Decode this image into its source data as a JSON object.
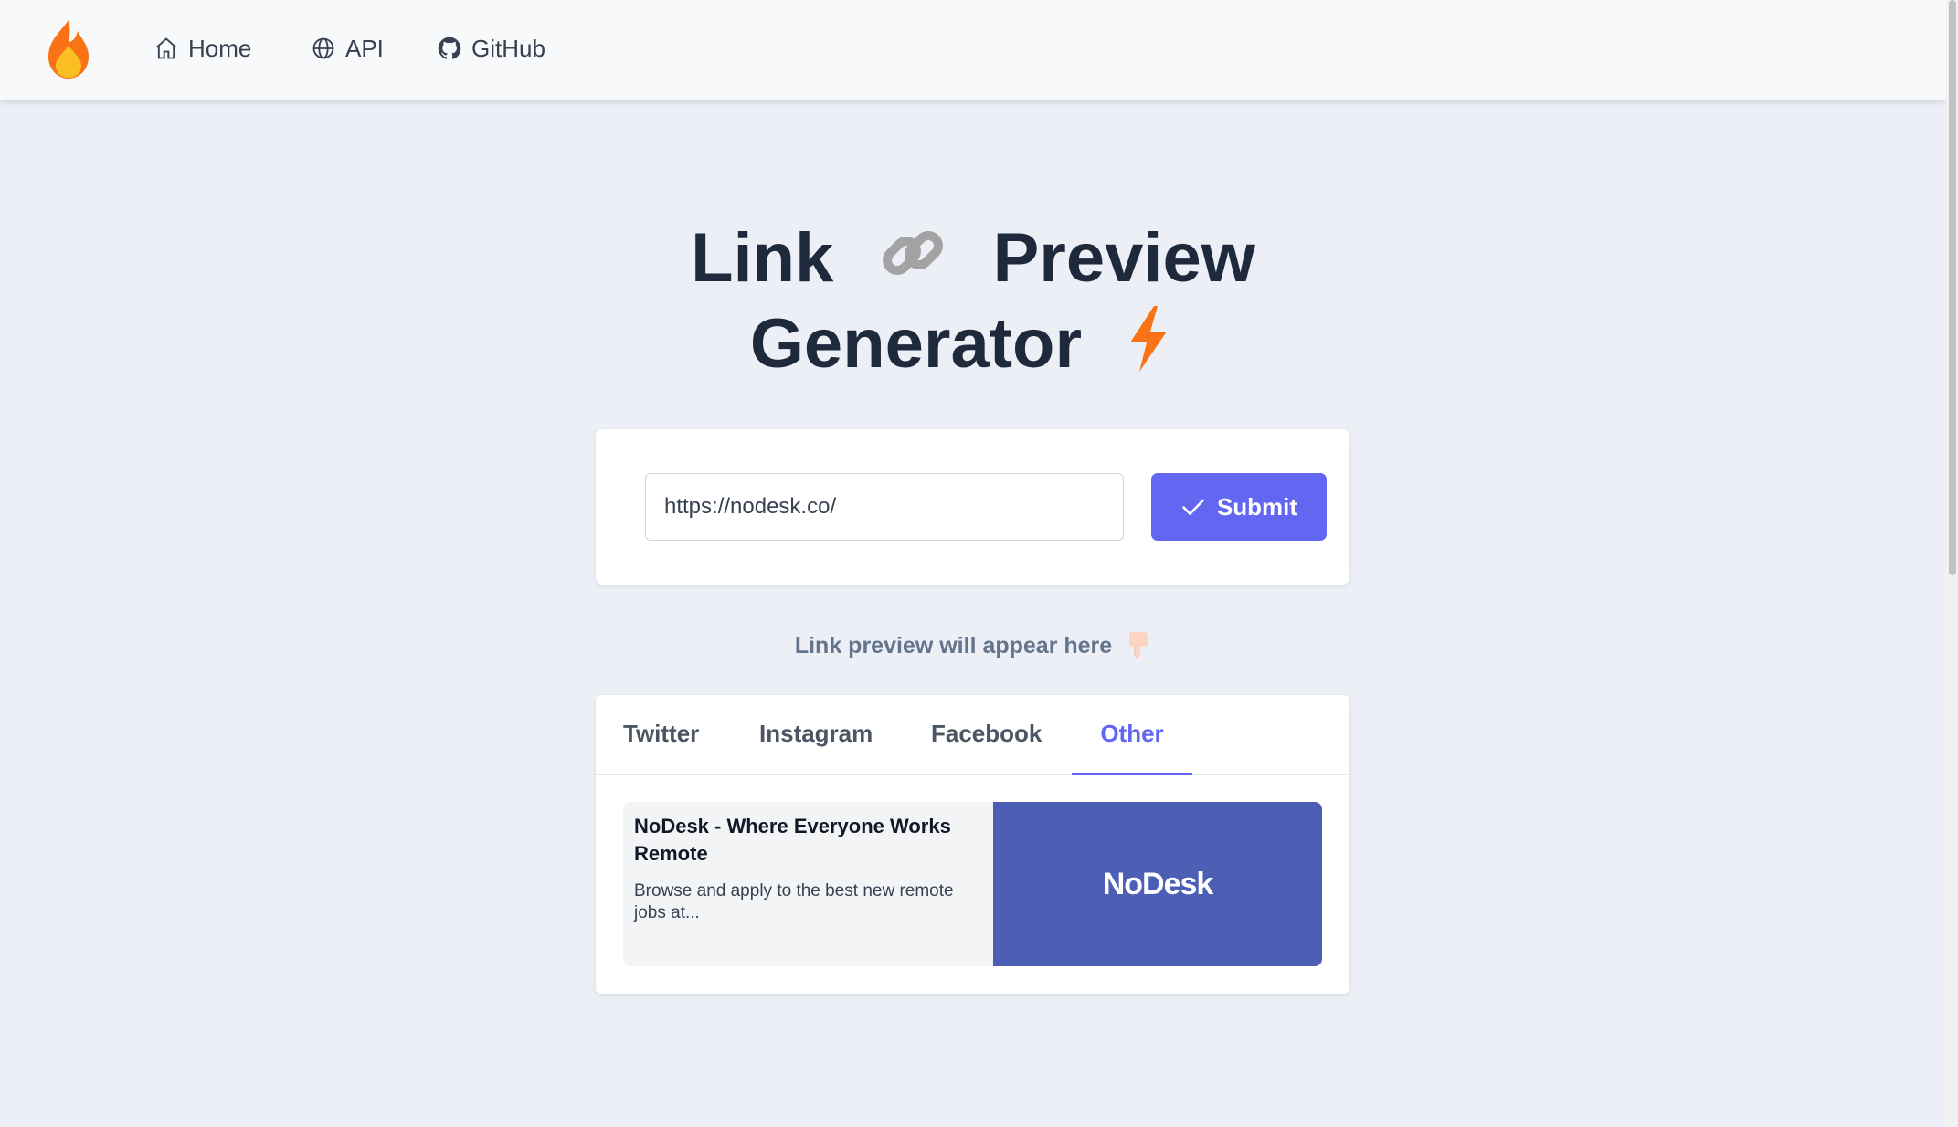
{
  "nav": {
    "logo_icon": "flame-icon",
    "items": [
      {
        "label": "Home",
        "icon": "home-icon"
      },
      {
        "label": "API",
        "icon": "globe-icon"
      },
      {
        "label": "GitHub",
        "icon": "github-icon"
      }
    ]
  },
  "hero": {
    "title_word1": "Link",
    "title_word2": "Preview",
    "title_word3": "Generator",
    "emoji1": "link-icon",
    "emoji2": "lightning-icon"
  },
  "form": {
    "url_value": "https://nodesk.co/",
    "submit_label": "Submit",
    "submit_icon": "check-icon"
  },
  "hint": {
    "text": "Link preview will appear here",
    "emoji": "pointing-down-icon"
  },
  "tabs": {
    "items": [
      "Twitter",
      "Instagram",
      "Facebook",
      "Other"
    ],
    "active": "Other"
  },
  "preview": {
    "title": "NoDesk - Where Everyone Works Remote",
    "description": "Browse and apply to the best new remote jobs at...",
    "image_brand": "NoDesk"
  },
  "colors": {
    "accent": "#6366f1",
    "background": "#eceff6",
    "preview_image_bg": "#4d5fb5",
    "flame_outer": "#f97316",
    "flame_inner": "#fbbf24"
  }
}
